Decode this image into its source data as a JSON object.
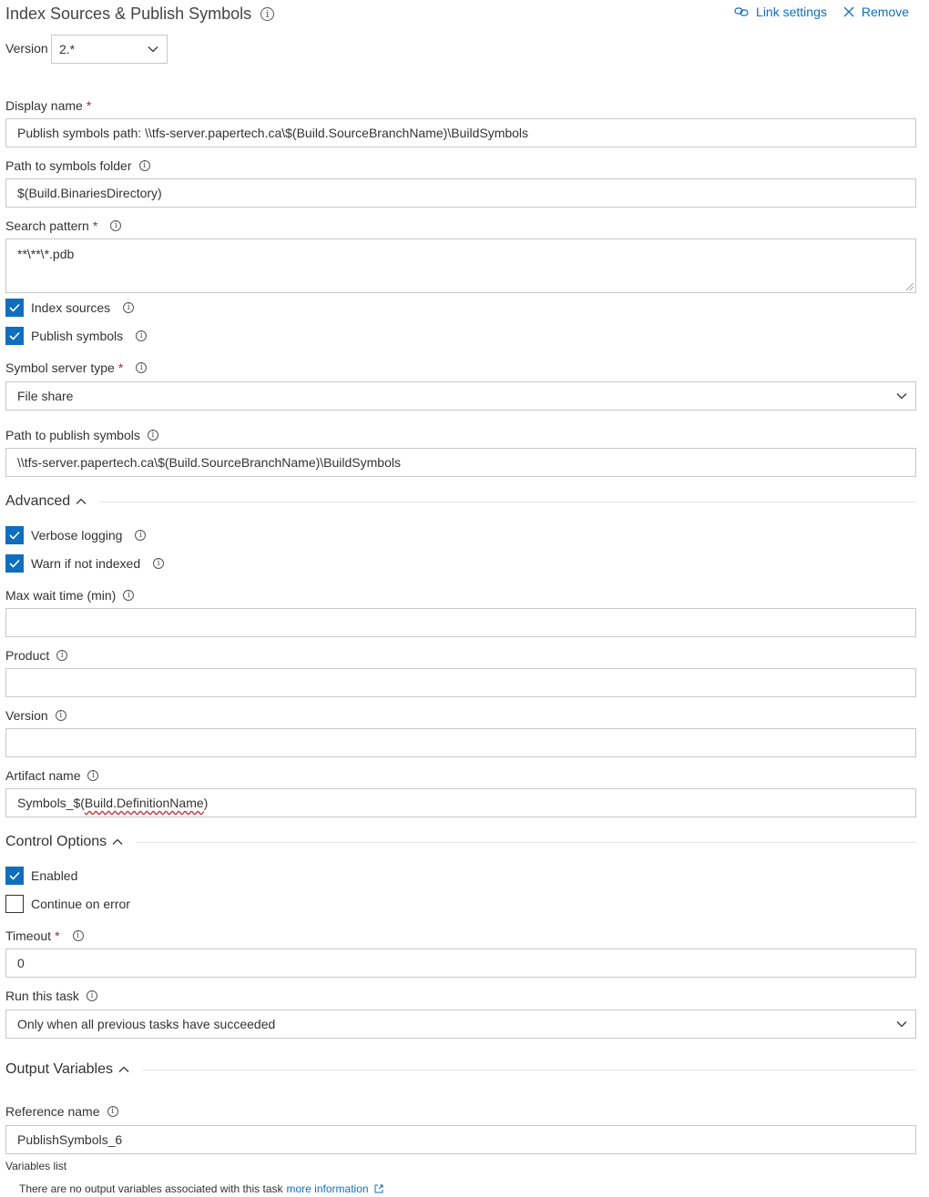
{
  "header": {
    "title": "Index Sources & Publish Symbols",
    "link_settings": "Link settings",
    "remove": "Remove"
  },
  "version_select": {
    "label": "Version",
    "value": "2.*"
  },
  "display_name": {
    "label": "Display name",
    "value": "Publish symbols path: \\\\tfs-server.papertech.ca\\$(Build.SourceBranchName)\\BuildSymbols"
  },
  "symbols_folder": {
    "label": "Path to symbols folder",
    "value": "$(Build.BinariesDirectory)"
  },
  "search_pattern": {
    "label": "Search pattern",
    "value": "**\\**\\*.pdb"
  },
  "index_sources": {
    "label": "Index sources",
    "checked": true
  },
  "publish_symbols": {
    "label": "Publish symbols",
    "checked": true
  },
  "server_type": {
    "label": "Symbol server type",
    "value": "File share"
  },
  "publish_path": {
    "label": "Path to publish symbols",
    "value": "\\\\tfs-server.papertech.ca\\$(Build.SourceBranchName)\\BuildSymbols"
  },
  "advanced": {
    "title": "Advanced",
    "verbose_logging": "Verbose logging",
    "warn_not_indexed": "Warn if not indexed",
    "max_wait": {
      "label": "Max wait time (min)",
      "value": ""
    },
    "product": {
      "label": "Product",
      "value": ""
    },
    "version": {
      "label": "Version",
      "value": ""
    },
    "artifact": {
      "label": "Artifact name",
      "prefix": "Symbols_$(",
      "spelled": "Build.DefinitionName",
      "suffix": ")"
    }
  },
  "control": {
    "title": "Control Options",
    "enabled": "Enabled",
    "continue_on_error": "Continue on error",
    "timeout": {
      "label": "Timeout",
      "value": "0"
    },
    "run_task": {
      "label": "Run this task",
      "value": "Only when all previous tasks have succeeded"
    }
  },
  "output": {
    "title": "Output Variables",
    "reference": {
      "label": "Reference name",
      "value": "PublishSymbols_6"
    },
    "variables_list": "Variables list",
    "no_vars": "There are no output variables associated with this task",
    "more_info": "more information"
  },
  "colors": {
    "accent": "#106ebe",
    "required": "#a4262c"
  }
}
